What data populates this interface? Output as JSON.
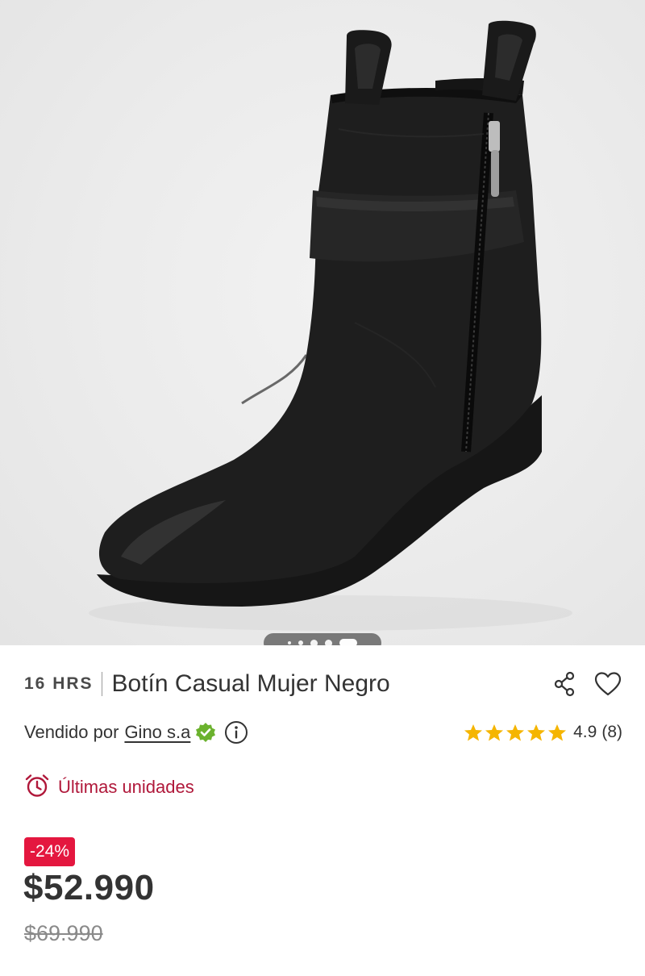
{
  "product": {
    "brand": "16 HRS",
    "title": "Botín Casual Mujer Negro",
    "image_alt": "Botín negro de cuero con cierre lateral y correa",
    "image_count": 5,
    "active_image": 5
  },
  "seller": {
    "prefix": "Vendido por",
    "name": "Gino s.a"
  },
  "rating": {
    "value": "4.9",
    "count": "(8)",
    "stars": 5
  },
  "stock": {
    "label": "Últimas unidades"
  },
  "pricing": {
    "discount": "-24%",
    "price": "$52.990",
    "old_price": "$69.990"
  },
  "colors": {
    "accent_red": "#e4173f",
    "stock_red": "#b0183a",
    "star_yellow": "#f5b500",
    "verified_green": "#6bb22e"
  },
  "icons": {
    "share": "share-icon",
    "favorite": "heart-icon",
    "verified": "verified-badge-icon",
    "info": "info-icon",
    "stock": "alarm-clock-icon",
    "star": "star-icon"
  }
}
